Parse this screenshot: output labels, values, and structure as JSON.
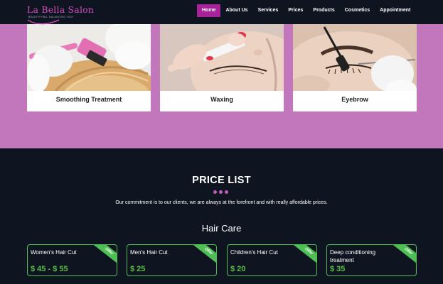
{
  "brand": {
    "name": "La Bella Salon",
    "tagline": "BEAUTIFYING, BALANCING YOU!"
  },
  "nav": {
    "items": [
      {
        "label": "Home",
        "active": true
      },
      {
        "label": "About Us",
        "active": false
      },
      {
        "label": "Services",
        "active": false
      },
      {
        "label": "Prices",
        "active": false
      },
      {
        "label": "Products",
        "active": false
      },
      {
        "label": "Cosmetics",
        "active": false
      },
      {
        "label": "Appointment",
        "active": false
      }
    ]
  },
  "services": [
    {
      "title": "Smoothing Treatment"
    },
    {
      "title": "Waxing"
    },
    {
      "title": "Eyebrow"
    }
  ],
  "pricing": {
    "title": "PRICE LIST",
    "subtitle": "Our commitment is to our clients, we are always at the forefront and with really affordable prices.",
    "category": "Hair Care",
    "badge": "Offer",
    "items": [
      {
        "name": "Women's Hair Cut",
        "price": "$ 45 - $ 55"
      },
      {
        "name": "Men's Hair Cut",
        "price": "$ 25"
      },
      {
        "name": "Children's Hair Cut",
        "price": "$ 20"
      },
      {
        "name": "Deep conditioning treatment",
        "price": "$ 35"
      }
    ]
  },
  "colors": {
    "accent": "#a6239a",
    "band": "#c276bb",
    "background": "#0f1520",
    "offer_green": "#4fbf55"
  }
}
